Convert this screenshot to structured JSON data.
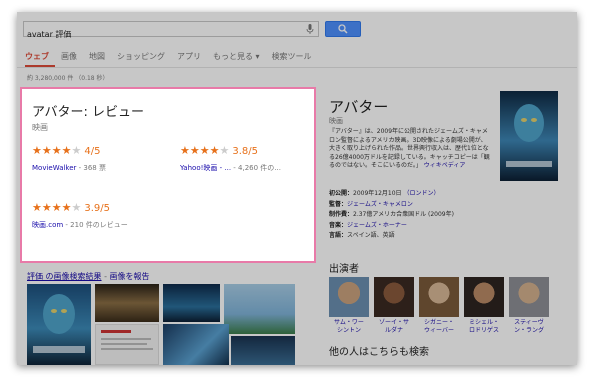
{
  "search": {
    "query": "avatar 評価"
  },
  "tabs": [
    "ウェブ",
    "画像",
    "地図",
    "ショッピング",
    "アプリ",
    "もっと見る ▾",
    "検索ツール"
  ],
  "result_stats": "約 3,280,000 件 （0.18 秒）",
  "review_card": {
    "title": "アバター: レビュー",
    "subtitle": "映画",
    "reviews": [
      {
        "rating": 4,
        "score": "4/5",
        "source": "MovieWalker",
        "detail": " - 368 票"
      },
      {
        "rating": 4,
        "score": "3.8/5",
        "source": "Yahoo!映画 - ...",
        "detail": " - 4,260 件の..."
      },
      {
        "rating": 4,
        "score": "3.9/5",
        "source": "映画.com",
        "detail": " - 210 件のレビュー"
      }
    ]
  },
  "images_section": {
    "link": "評価",
    "link_rest": " の画像検索結果",
    "separator": " - ",
    "report": "画像を報告"
  },
  "knowledge_panel": {
    "title": "アバター",
    "type": "映画",
    "description": "『アバター』は、2009年に公開されたジェームズ・キャメロン監督によるアメリカ映画。3D映像による劇場公開が、大きく取り上げられた作品。世界興行収入は、歴代1位となる26億4000万ドルを記録している。キャッチコピーは「観るのではない。そこにいるのだ。」",
    "wiki": "ウィキペディア",
    "facts": [
      {
        "label": "初公開：",
        "value": "2009年12月10日",
        "link": "（ロンドン）"
      },
      {
        "label": "監督：",
        "value": "",
        "link": "ジェームズ・キャメロン"
      },
      {
        "label": "制作費：",
        "value": "2.37億アメリカ合衆国ドル (2009年)",
        "link": ""
      },
      {
        "label": "音楽：",
        "value": "",
        "link": "ジェームズ・ホーナー"
      },
      {
        "label": "言語：",
        "value": "スペイン語、英語",
        "link": ""
      }
    ],
    "cast_title": "出演者",
    "cast": [
      {
        "line1": "サム・ワー",
        "line2": "シントン"
      },
      {
        "line1": "ゾーイ・サ",
        "line2": "ルダナ"
      },
      {
        "line1": "シガニー・",
        "line2": "ウィーバー"
      },
      {
        "line1": "ミシェル・",
        "line2": "ロドリゲス"
      },
      {
        "line1": "スティーヴ",
        "line2": "ン・ラング"
      }
    ],
    "more_title": "他の人はこちらも検索"
  },
  "colors": {
    "accent_red": "#dd4b39",
    "star_orange": "#e7711b",
    "link_blue": "#1a0dab",
    "highlight_pink": "#e87aa8",
    "search_blue": "#4d90fe"
  }
}
